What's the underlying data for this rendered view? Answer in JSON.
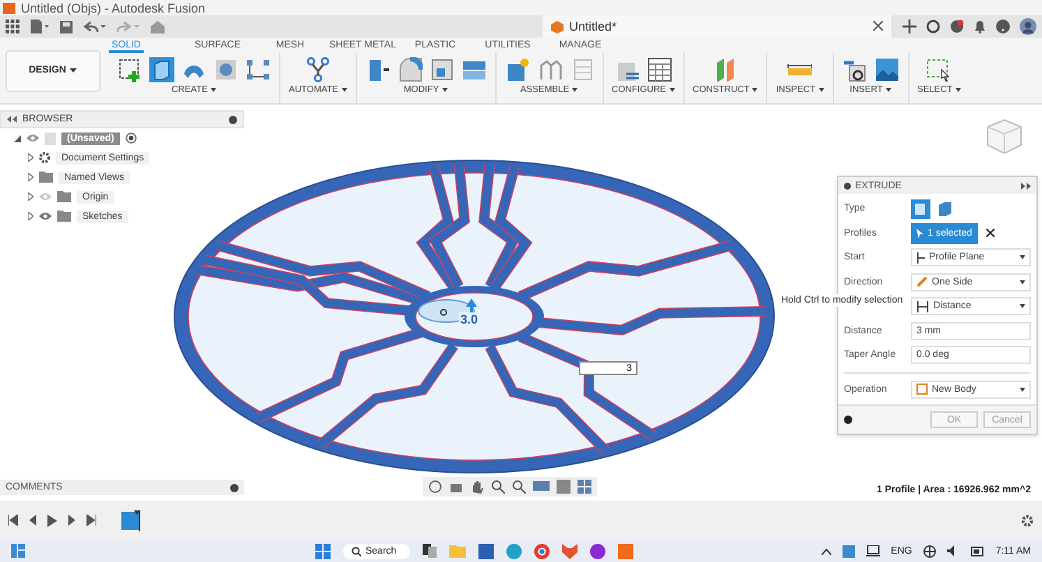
{
  "window": {
    "title": "Untitled (Objs) - Autodesk Fusion"
  },
  "toolbar": {
    "document_tab": "Untitled*"
  },
  "workspace": {
    "label": "DESIGN"
  },
  "tabs": [
    {
      "label": "SOLID",
      "selected": true
    },
    {
      "label": "SURFACE",
      "selected": false
    },
    {
      "label": "MESH",
      "selected": false
    },
    {
      "label": "SHEET METAL",
      "selected": false
    },
    {
      "label": "PLASTIC",
      "selected": false
    },
    {
      "label": "UTILITIES",
      "selected": false
    },
    {
      "label": "MANAGE",
      "selected": false
    }
  ],
  "ribbon_groups": [
    {
      "label": "CREATE"
    },
    {
      "label": "AUTOMATE"
    },
    {
      "label": "MODIFY"
    },
    {
      "label": "ASSEMBLE"
    },
    {
      "label": "CONFIGURE"
    },
    {
      "label": "CONSTRUCT"
    },
    {
      "label": "INSPECT"
    },
    {
      "label": "INSERT"
    },
    {
      "label": "SELECT"
    }
  ],
  "browser": {
    "title": "BROWSER",
    "items": [
      {
        "label": "(Unsaved)",
        "kind": "root",
        "expanded": true,
        "children": [
          {
            "label": "Document Settings",
            "kind": "settings",
            "expanded": false
          },
          {
            "label": "Named Views",
            "kind": "folder",
            "expanded": false
          },
          {
            "label": "Origin",
            "kind": "folder",
            "expanded": false,
            "visible": false
          },
          {
            "label": "Sketches",
            "kind": "folder",
            "expanded": false,
            "visible": true
          }
        ]
      }
    ]
  },
  "canvas": {
    "manipulator_label": "3.0",
    "dimension_value": "3",
    "tooltip": "Hold Ctrl to modify selection",
    "status": "1 Profile | Area : 16926.962 mm^2"
  },
  "extrude": {
    "title": "EXTRUDE",
    "rows": [
      {
        "kind": "type",
        "label": "Type"
      },
      {
        "kind": "selection",
        "label": "Profiles",
        "value": "1 selected"
      },
      {
        "kind": "dropdown",
        "label": "Start",
        "value": "Profile Plane"
      },
      {
        "kind": "dropdown",
        "label": "Direction",
        "value": "One Side"
      },
      {
        "kind": "dropdown",
        "value": "Distance"
      },
      {
        "kind": "input",
        "label": "Distance",
        "value": "3 mm"
      },
      {
        "kind": "input",
        "label": "Taper Angle",
        "value": "0.0 deg"
      },
      {
        "kind": "dropdown",
        "label": "Operation",
        "value": "New Body"
      }
    ],
    "buttons": [
      {
        "label": "OK"
      },
      {
        "label": "Cancel"
      }
    ]
  },
  "comments": {
    "title": "COMMENTS"
  },
  "taskbar": {
    "search": "Search",
    "language": "ENG",
    "time": "7:11 AM"
  }
}
